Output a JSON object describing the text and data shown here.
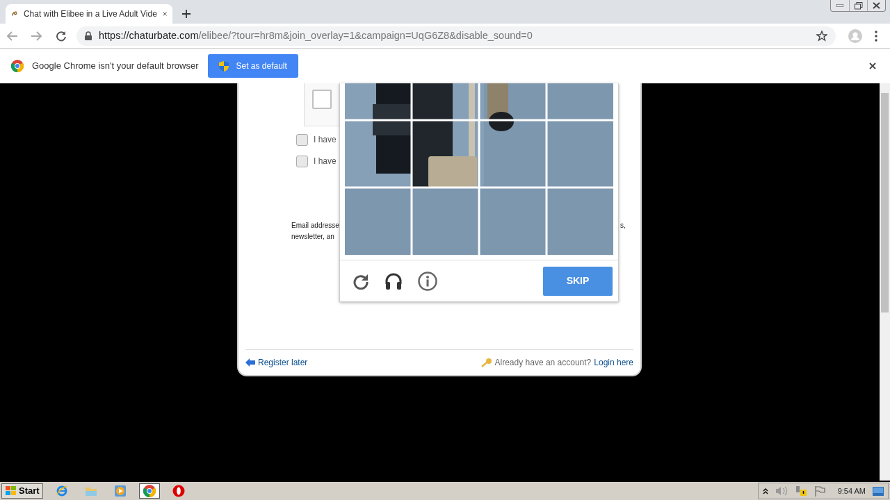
{
  "tab": {
    "title": "Chat with Elibee in a Live Adult Vide",
    "selected": true
  },
  "address": {
    "host": "https://chaturbate.com",
    "path": "/elibee/?tour=hr8m&join_overlay=1&campaign=UqG6Z8&disable_sound=0"
  },
  "infobar": {
    "message": "Google Chrome isn't your default browser",
    "button": "Set as default"
  },
  "form": {
    "agreements": [
      {
        "label": "I have",
        "checked": false
      },
      {
        "label": "I have",
        "checked": false
      }
    ],
    "note_lines": [
      "Email addresse",
      "newsletter, an"
    ],
    "note_right": "s,",
    "register_later": "Register later",
    "login_prompt": "Already have an account?",
    "login_link": "Login here"
  },
  "captcha": {
    "checked": false,
    "skip": "SKIP"
  },
  "taskbar": {
    "start": "Start",
    "apps": [
      {
        "kind": "ie",
        "selected": false
      },
      {
        "kind": "folder",
        "selected": false
      },
      {
        "kind": "media",
        "selected": false
      },
      {
        "kind": "chrome",
        "selected": true
      },
      {
        "kind": "opera",
        "selected": false
      }
    ],
    "clock": "9:54 AM"
  }
}
